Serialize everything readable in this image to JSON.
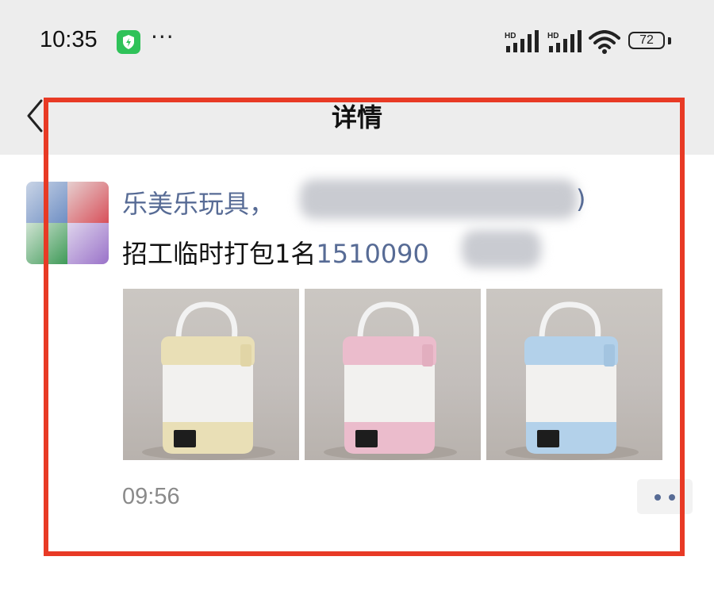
{
  "status_bar": {
    "time": "10:35",
    "dots": "···",
    "signal_1_label": "HD",
    "signal_2_label": "HD",
    "battery": "72"
  },
  "nav": {
    "title": "详情"
  },
  "post": {
    "poster_name_visible": "乐美乐玩具，",
    "poster_name_end": ")",
    "text": "招工临时打包1名",
    "phone_visible": "1510090",
    "time": "09:56",
    "photos": [
      {
        "color": "cream",
        "body_hex": "#e9dfb6"
      },
      {
        "color": "pink",
        "body_hex": "#ebbccc"
      },
      {
        "color": "blue",
        "body_hex": "#b3d1ea"
      }
    ]
  },
  "colors": {
    "link": "#576b95",
    "highlight": "#e83a25",
    "bar_background": "#ededed"
  }
}
